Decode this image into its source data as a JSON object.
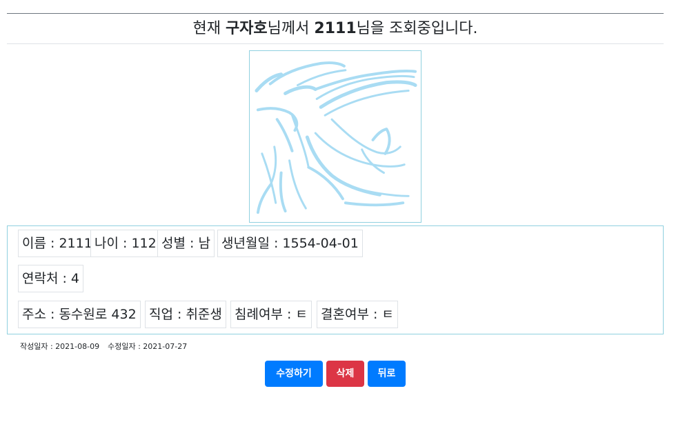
{
  "header": {
    "prefix": "현재 ",
    "viewer": "구자호",
    "middle": "님께서 ",
    "target": "2111",
    "suffix": "님을 조회중입니다."
  },
  "profile": {
    "photo_icon": "dove-icon",
    "row1": [
      "이름 : 2111",
      "나이 : 112",
      "성별 : 남",
      "생년월일 : 1554-04-01"
    ],
    "row2": [
      "연락처 : 4"
    ],
    "row3": [
      "주소 : 동수원로 432",
      "직업 : 취준생",
      "침례여부 : ㅌ",
      "결혼여부 : ㅌ"
    ]
  },
  "meta": {
    "created": "작성일자 : 2021-08-09",
    "modified": "수정일자 : 2021-07-27"
  },
  "actions": {
    "edit_label": "수정하기",
    "delete_label": "삭제",
    "back_label": "뒤로"
  },
  "colors": {
    "primary": "#007bff",
    "danger": "#dc3545",
    "frame_border": "#8fd0df",
    "dove": "#a9dcf3"
  }
}
